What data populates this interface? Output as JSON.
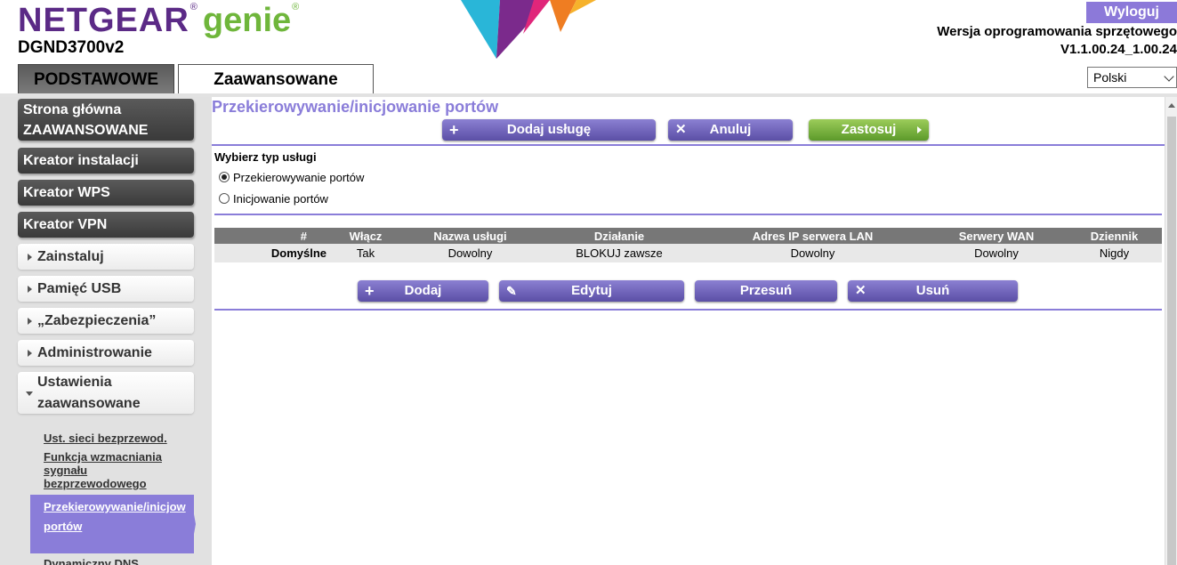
{
  "header": {
    "logo_netgear": "NETGEAR",
    "logo_reg": "®",
    "logo_genie": "genie",
    "logo_genie_reg": "®",
    "model": "DGND3700v2",
    "logout_label": "Wyloguj",
    "firmware_label": "Wersja oprogramowania sprzętowego",
    "firmware_value": "V1.1.00.24_1.00.24",
    "language": "Polski",
    "tab_basic": "PODSTAWOWE",
    "tab_advanced": "Zaawansowane"
  },
  "sidebar": {
    "home": [
      "Strona główna",
      "ZAAWANSOWANE"
    ],
    "setup_wizard": "Kreator instalacji",
    "wps_wizard": "Kreator WPS",
    "vpn_wizard": "Kreator VPN",
    "install": "Zainstaluj",
    "usb": "Pamięć USB",
    "security": "„Zabezpieczenia”",
    "admin": "Administrowanie",
    "advanced_settings": [
      "Ustawienia",
      "zaawansowane"
    ],
    "sub_items": [
      "Ust. sieci bezprzewod.",
      "Funkcja wzmacniania sygnału bezprzewodowego",
      "Przekierowywanie/inicjowanie portów",
      "Dynamiczny DNS"
    ],
    "sub_wireless": "Ust. sieci bezprzewod.",
    "sub_signal": "Funkcja wzmacniania sygnału bezprzewodowego",
    "sub_active_l1": "Przekierowywanie/inicjow",
    "sub_active_l2": "portów",
    "sub_ddns": "Dynamiczny DNS"
  },
  "main": {
    "title": "Przekierowywanie/inicjowanie portów",
    "add_service": "Dodaj usługę",
    "cancel": "Anuluj",
    "apply": "Zastosuj",
    "service_type_label": "Wybierz typ usługi",
    "radio_forwarding": "Przekierowywanie portów",
    "radio_triggering": "Inicjowanie portów",
    "table": {
      "headers": [
        "#",
        "Włącz",
        "Nazwa usługi",
        "Działanie",
        "Adres IP serwera LAN",
        "Serwery WAN",
        "Dziennik"
      ],
      "rows": [
        [
          "Domyślne",
          "Tak",
          "Dowolny",
          "BLOKUJ zawsze",
          "Dowolny",
          "Dowolny",
          "Nigdy"
        ]
      ]
    },
    "add": "Dodaj",
    "edit": "Edytuj",
    "move": "Przesuń",
    "delete": "Usuń"
  },
  "colors": {
    "brand_purple": "#5b2a86",
    "genie_green": "#6fb63b",
    "accent": "#8a7dd9",
    "apply_green": "#7ab646"
  }
}
